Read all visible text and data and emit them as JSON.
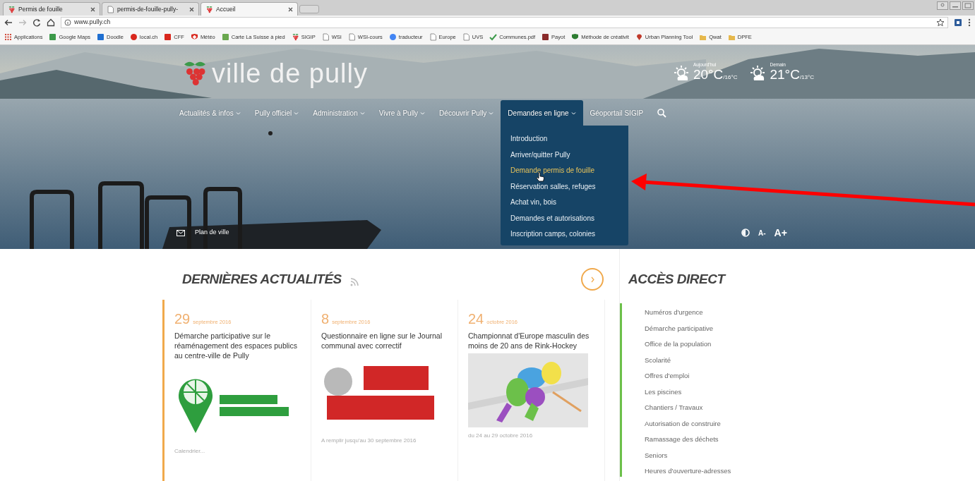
{
  "browser": {
    "tabs": [
      {
        "title": "Permis de fouille",
        "selected": false
      },
      {
        "title": "permis-de-fouille-pully-",
        "selected": false
      },
      {
        "title": "Accueil",
        "selected": true
      }
    ],
    "url": "www.pully.ch",
    "bookmarks": [
      "Applications",
      "Google Maps",
      "Doodle",
      "local.ch",
      "CFF",
      "Météo",
      "Carte La Suisse à pied",
      "SIGIP",
      "WSI",
      "WSI-cours",
      "traducteur",
      "Europe",
      "UVS",
      "Communes.pdf",
      "Payot",
      "Méthode de créativit",
      "Urban Planning Tool",
      "Qwat",
      "DPFE"
    ]
  },
  "hero": {
    "logo": "ville de pully",
    "weather": [
      {
        "label": "Aujourd'hui",
        "temp": "20°C",
        "low": "/16°C"
      },
      {
        "label": "Demain",
        "temp": "21°C",
        "low": "/13°C"
      }
    ],
    "nav": [
      {
        "label": "Actualités & infos",
        "dropdown": true,
        "selected": false
      },
      {
        "label": "Pully officiel",
        "dropdown": true,
        "selected": false
      },
      {
        "label": "Administration",
        "dropdown": true,
        "selected": false
      },
      {
        "label": "Vivre à Pully",
        "dropdown": true,
        "selected": false
      },
      {
        "label": "Découvrir Pully",
        "dropdown": true,
        "selected": false
      },
      {
        "label": "Demandes en ligne",
        "dropdown": true,
        "selected": true
      },
      {
        "label": "Géoportail SIGIP",
        "dropdown": false,
        "selected": false
      }
    ],
    "menu": [
      {
        "label": "Introduction",
        "hovered": false
      },
      {
        "label": "Arriver/quitter Pully",
        "hovered": false
      },
      {
        "label": "Demande permis de fouille",
        "hovered": true
      },
      {
        "label": "Réservation salles, refuges",
        "hovered": false
      },
      {
        "label": "Achat vin, bois",
        "hovered": false
      },
      {
        "label": "Demandes et autorisations",
        "hovered": false
      },
      {
        "label": "Inscription camps, colonies",
        "hovered": false
      }
    ],
    "map_link": "Plan de ville",
    "font_smaller": "A-",
    "font_larger": "A+"
  },
  "news": {
    "title": "DERNIÈRES ACTUALITÉS",
    "items": [
      {
        "day": "29",
        "month": "septembre 2016",
        "title": "Démarche participative sur le réaménagement des espaces publics au centre-ville de Pully",
        "caption": "Calendrier..."
      },
      {
        "day": "8",
        "month": "septembre 2016",
        "title": "Questionnaire en ligne sur le Journal communal avec correctif",
        "caption": "A remplir jusqu'au 30 septembre 2016"
      },
      {
        "day": "24",
        "month": "octobre 2016",
        "title": "Championnat d'Europe masculin des moins de 20 ans de Rink-Hockey",
        "caption": "du 24 au 29 octobre 2016"
      }
    ]
  },
  "direct_access": {
    "title": "ACCÈS DIRECT",
    "links": [
      "Numéros d'urgence",
      "Démarche participative",
      "Office de la population",
      "Scolarité",
      "Offres d'emploi",
      "Les piscines",
      "Chantiers / Travaux",
      "Autorisation de construire",
      "Ramassage des déchets",
      "Seniors",
      "Heures d'ouverture-adresses"
    ]
  }
}
